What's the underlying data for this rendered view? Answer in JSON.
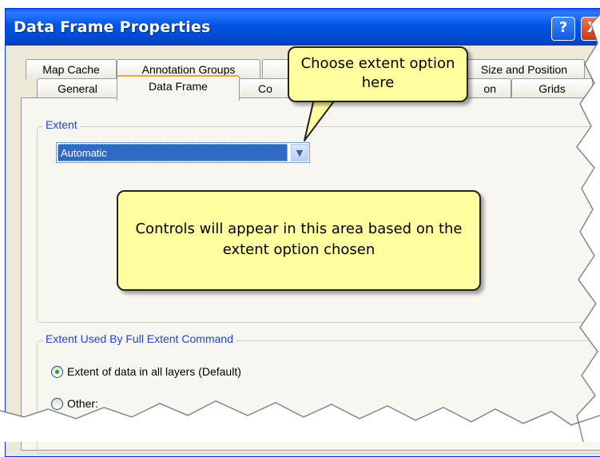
{
  "window": {
    "title": "Data Frame Properties",
    "help_glyph": "?",
    "close_glyph": "X"
  },
  "tabs_back": [
    "Map Cache",
    "Annotation Groups",
    "Size and Position"
  ],
  "tabs_front": [
    "General",
    "Data Frame",
    "Co",
    "on",
    "Grids"
  ],
  "active_tab": "Data Frame",
  "extent_group": {
    "legend": "Extent",
    "select_value": "Automatic"
  },
  "full_extent_group": {
    "legend": "Extent Used By Full Extent Command",
    "options": [
      {
        "label": "Extent of data in all layers (Default)",
        "checked": true
      },
      {
        "label": "Other:",
        "checked": false
      }
    ]
  },
  "callouts": {
    "top": "Choose extent option here",
    "middle": "Controls will appear in this area based on the extent option chosen"
  },
  "colors": {
    "title_bar": "#0054e3",
    "dialog_bg": "#ece9d8",
    "callout_bg": "#ffffa0",
    "group_label": "#2244cc"
  }
}
